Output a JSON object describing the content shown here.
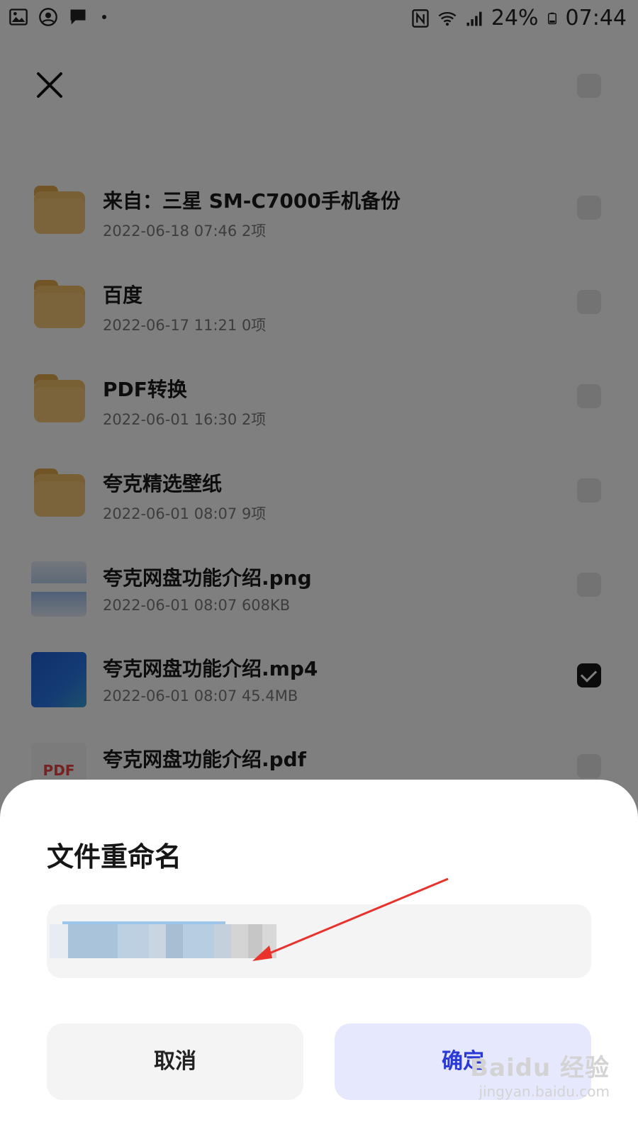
{
  "status_bar": {
    "battery": "24%",
    "time": "07:44",
    "icons_left": [
      "gallery-icon",
      "account-icon",
      "message-icon"
    ],
    "icons_right": [
      "nfc-icon",
      "wifi-icon",
      "signal-icon",
      "battery-icon"
    ]
  },
  "files": [
    {
      "name": "来自：三星 SM-C7000手机备份",
      "date": "2022-06-18 07:46",
      "size": "2项",
      "type": "folder",
      "checked": false
    },
    {
      "name": "百度",
      "date": "2022-06-17 11:21",
      "size": "0项",
      "type": "folder",
      "checked": false
    },
    {
      "name": "PDF转换",
      "date": "2022-06-01 16:30",
      "size": "2项",
      "type": "folder",
      "checked": false
    },
    {
      "name": "夸克精选壁纸",
      "date": "2022-06-01 08:07",
      "size": "9项",
      "type": "folder",
      "checked": false
    },
    {
      "name": "夸克网盘功能介绍.png",
      "date": "2022-06-01 08:07",
      "size": "608KB",
      "type": "image",
      "checked": false
    },
    {
      "name": "夸克网盘功能介绍.mp4",
      "date": "2022-06-01 08:07",
      "size": "45.4MB",
      "type": "video",
      "checked": true
    },
    {
      "name": "夸克网盘功能介绍.pdf",
      "date": "",
      "size": "",
      "type": "pdf",
      "checked": false
    }
  ],
  "pdf_thumb_label": "PDF",
  "dialog": {
    "title": "文件重命名",
    "input_value": "",
    "cancel_label": "取消",
    "confirm_label": "确定"
  },
  "watermark": {
    "brand": "Baidu 经验",
    "url": "jingyan.baidu.com"
  },
  "colors": {
    "folder": "#f2c069",
    "confirm_text": "#2b3ad6",
    "confirm_bg": "#e6e9fd",
    "arrow": "#e8322b"
  }
}
